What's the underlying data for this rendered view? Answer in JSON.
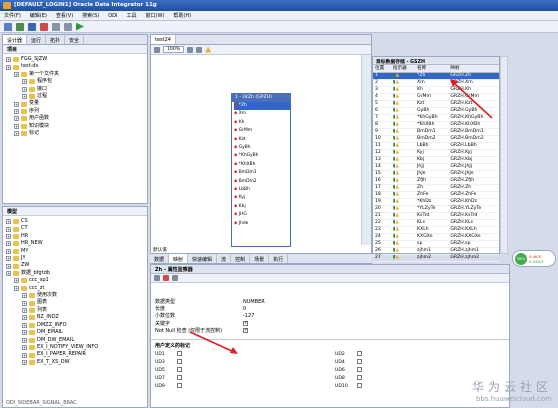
{
  "window": {
    "title": "[DEFAULT_LOGIN1] Oracle Data Integrator 11g"
  },
  "menu": [
    "文件(F)",
    "编辑(E)",
    "查看(V)",
    "搜索(S)",
    "ODI",
    "工具",
    "窗口(W)",
    "帮助(H)"
  ],
  "left_top": {
    "tabs": [
      "设计器",
      "运行",
      "拓扑",
      "安全"
    ],
    "section_label": "项目",
    "tree": [
      {
        "label": "FGG_SJZW",
        "indent": 0
      },
      {
        "label": "test-ds",
        "indent": 0
      },
      {
        "label": "第一个文件夹",
        "indent": 1
      },
      {
        "label": "程序包",
        "indent": 2
      },
      {
        "label": "接口",
        "indent": 2
      },
      {
        "label": "过程",
        "indent": 2
      },
      {
        "label": "变量",
        "indent": 1
      },
      {
        "label": "序列",
        "indent": 1
      },
      {
        "label": "用户函数",
        "indent": 1
      },
      {
        "label": "知识模块",
        "indent": 1
      },
      {
        "label": "标记",
        "indent": 1
      }
    ]
  },
  "left_bottom": {
    "section_label": "模型",
    "tree": [
      {
        "label": "CS",
        "indent": 0
      },
      {
        "label": "CT",
        "indent": 0
      },
      {
        "label": "HR",
        "indent": 0
      },
      {
        "label": "HR_NEW",
        "indent": 0
      },
      {
        "label": "MY",
        "indent": 0
      },
      {
        "label": "JY",
        "indent": 0
      },
      {
        "label": "ZW",
        "indent": 0
      },
      {
        "label": "数据_bfgtdb",
        "indent": 0
      },
      {
        "label": "ccc_sp1",
        "indent": 1
      },
      {
        "label": "ccc_zt",
        "indent": 1
      },
      {
        "label": "使用次数",
        "indent": 2
      },
      {
        "label": "图表",
        "indent": 2
      },
      {
        "label": "列表",
        "indent": 2
      },
      {
        "label": "BZ_INDZ",
        "indent": 2
      },
      {
        "label": "DMZZ_INFO",
        "indent": 2
      },
      {
        "label": "DM_EMAIL",
        "indent": 2
      },
      {
        "label": "DM_DW_EMAIL",
        "indent": 2
      },
      {
        "label": "EX_I_NOTIFY_VIEW_INFO",
        "indent": 2
      },
      {
        "label": "EX_I_PAPER_REPAIR",
        "indent": 2
      },
      {
        "label": "EX_T_XS_DW",
        "indent": 2
      }
    ],
    "footer": "ODI_SIDEBAR_SIGNAL_BRAC"
  },
  "editor": {
    "tab": "test24",
    "zoom": "100%",
    "table_box": {
      "title": "1 - GtZh (GPZH)",
      "rows": [
        "*Zh",
        "Xm",
        "Kh",
        "GrMm",
        "Kzt",
        "GyBh",
        "*KhGyBh",
        "*KhXBh",
        "BmDm1",
        "BmDm2",
        "LbBh",
        "Kyj",
        "Kbj",
        "JHG",
        "Jhde"
      ]
    },
    "bottom_tabs": [
      "数据",
      "映射",
      "快速编辑",
      "流",
      "控制",
      "场景",
      "执行"
    ],
    "side_tab": "默认值"
  },
  "target": {
    "title": "目标数据存储 - GSZH",
    "columns": [
      "位置",
      "指示器",
      "名称",
      "映射"
    ],
    "rows": [
      {
        "pos": "1",
        "name": "*Zh",
        "map": "GRZH.Zh"
      },
      {
        "pos": "2",
        "name": "Xm",
        "map": "GRZH.Xm"
      },
      {
        "pos": "3",
        "name": "Kh",
        "map": "GRZH.Kh"
      },
      {
        "pos": "4",
        "name": "GrMm",
        "map": "GRZH.GrMm"
      },
      {
        "pos": "5",
        "name": "Kzt",
        "map": "GRZH.Kzt"
      },
      {
        "pos": "6",
        "name": "GyBh",
        "map": "GRZH.GyBh"
      },
      {
        "pos": "7",
        "name": "*KhGyBh",
        "map": "GRZH.KhGyBh"
      },
      {
        "pos": "8",
        "name": "*KhXBh",
        "map": "GRZH.KhXBh"
      },
      {
        "pos": "9",
        "name": "BmDm1",
        "map": "GRZH.BmDm1"
      },
      {
        "pos": "10",
        "name": "BmDm2",
        "map": "GRZH.BmDm2"
      },
      {
        "pos": "11",
        "name": "LbBh",
        "map": "GRZH.LbBh"
      },
      {
        "pos": "12",
        "name": "Kyj",
        "map": "GRZH.Kyj"
      },
      {
        "pos": "13",
        "name": "Kbj",
        "map": "GRZH.Kbj"
      },
      {
        "pos": "14",
        "name": "JhJj",
        "map": "GRZH.JhJj"
      },
      {
        "pos": "15",
        "name": "JhJe",
        "map": "GRZH.JhJe"
      },
      {
        "pos": "16",
        "name": "ZfJh",
        "map": "GRZH.ZfJh"
      },
      {
        "pos": "17",
        "name": "Zh",
        "map": "GRZH.Zh"
      },
      {
        "pos": "18",
        "name": "ZhFe",
        "map": "GRZH.ZhFe"
      },
      {
        "pos": "19",
        "name": "*KhDz",
        "map": "GRZH.KhDz"
      },
      {
        "pos": "20",
        "name": "*YLZyTe",
        "map": "GRZH.YLZyTe"
      },
      {
        "pos": "21",
        "name": "KsTrd",
        "map": "GRZH.KsTrd"
      },
      {
        "pos": "22",
        "name": "KLs",
        "map": "GRZH.KLs"
      },
      {
        "pos": "23",
        "name": "KXLh",
        "map": "GRZH.KXLh"
      },
      {
        "pos": "24",
        "name": "KXGXe",
        "map": "GRZH.KXGXe"
      },
      {
        "pos": "25",
        "name": "sp",
        "map": "GRZH.sp"
      },
      {
        "pos": "26",
        "name": "zjhm1",
        "map": "GRZH.zjhm1"
      },
      {
        "pos": "27",
        "name": "zjhm2",
        "map": "GRZH.zjhm2"
      }
    ]
  },
  "properties": {
    "header": "Zh - 属性监察器",
    "fields": [
      {
        "label": "数据类型",
        "value": "NUMBER"
      },
      {
        "label": "长度",
        "value": "0"
      },
      {
        "label": "小数位数",
        "value": "-127"
      },
      {
        "label": "关键字",
        "value": ""
      },
      {
        "label": "Not Null 检查 (仅限于流控制)",
        "value": ""
      }
    ],
    "user_flags_title": "用户定义的标记",
    "flags": [
      "UD1",
      "UD2",
      "UD3",
      "UD4",
      "UD5",
      "UD6",
      "UD7",
      "UD8",
      "UD9",
      "UD10"
    ]
  },
  "status_widget": {
    "top": "0.4K/S",
    "bottom": "0.04K/S",
    "percent": "58%"
  },
  "watermark": {
    "cn": "华为云社区",
    "url": "bbs.huaweicloud.com"
  },
  "colors": {
    "accent": "#3266c8",
    "arrow": "#e02020"
  }
}
